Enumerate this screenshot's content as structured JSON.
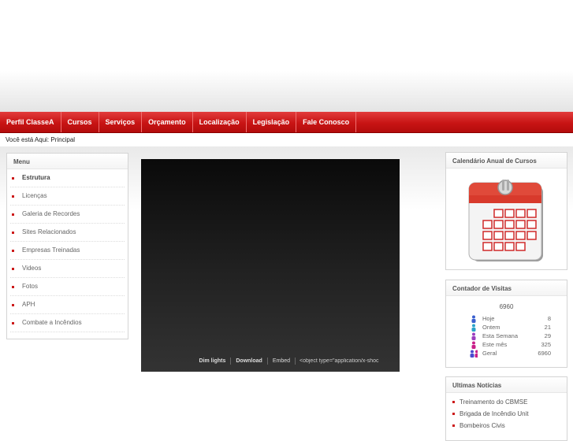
{
  "nav": {
    "items": [
      "Perfil ClasseA",
      "Cursos",
      "Serviços",
      "Orçamento",
      "Localização",
      "Legislação",
      "Fale Conosco"
    ]
  },
  "breadcrumb": {
    "text": "Você está Aqui: Principal"
  },
  "menu": {
    "title": "Menu",
    "items": [
      {
        "label": "Estrutura",
        "active": true
      },
      {
        "label": "Licenças"
      },
      {
        "label": "Galeria de Recordes"
      },
      {
        "label": "Sites Relacionados"
      },
      {
        "label": "Empresas Treinadas"
      },
      {
        "label": "Videos"
      },
      {
        "label": "Fotos"
      },
      {
        "label": "APH"
      },
      {
        "label": "Combate a Incêndios"
      }
    ]
  },
  "video": {
    "dim_lights": "Dim lights",
    "download": "Download",
    "embed": "Embed",
    "embed_code": "<object type=\"application/x-shoc"
  },
  "calendar": {
    "title": "Calendário Anual de Cursos",
    "icon": "calendar-icon"
  },
  "counter": {
    "title": "Contador de Visitas",
    "total": "6960",
    "rows": [
      {
        "label": "Hoje",
        "value": "8",
        "color": "#3a5fcf"
      },
      {
        "label": "Ontem",
        "value": "21",
        "color": "#2aa3c9"
      },
      {
        "label": "Esta Semana",
        "value": "29",
        "color": "#9b3fbf"
      },
      {
        "label": "Este mês",
        "value": "325",
        "color": "#c9208a"
      },
      {
        "label": "Geral",
        "value": "6960",
        "color": "#4a4acf"
      }
    ]
  },
  "news": {
    "title": "Ultimas Notícias",
    "items": [
      "Treinamento do CBMSE",
      "Brigada de Incêndio Unit",
      "Bombeiros Civis"
    ]
  },
  "colors": {
    "accent": "#c81414",
    "bullet": "#cc1a1a"
  }
}
